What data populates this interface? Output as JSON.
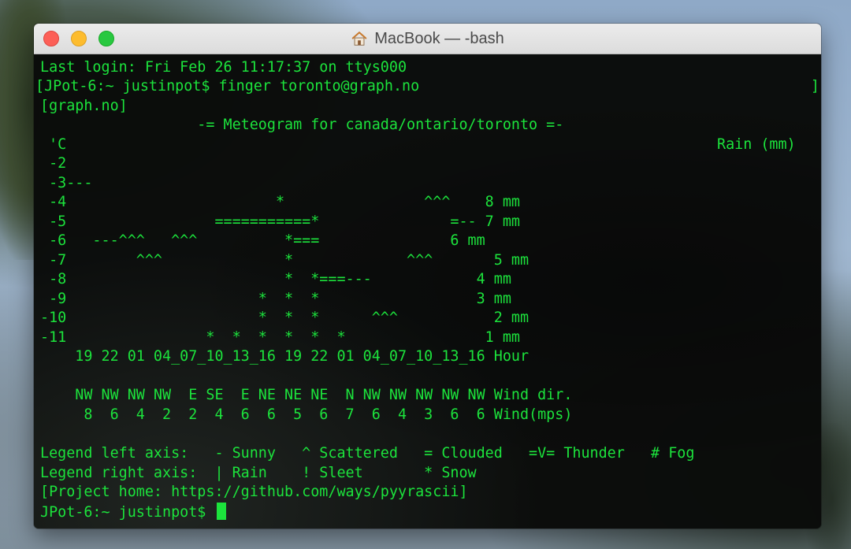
{
  "window": {
    "title": "MacBook — -bash",
    "icons": {
      "title_icon": "home-icon",
      "close": "close-button-icon",
      "minimize": "minimize-button-icon",
      "zoom": "zoom-button-icon"
    },
    "colors": {
      "close": "#fc5f57",
      "minimize": "#fdbc2e",
      "zoom": "#28c840",
      "terminal_text": "#1ce33c"
    }
  },
  "terminal": {
    "login_line": "Last login: Fri Feb 26 11:17:37 on ttys000",
    "command_line": "[JPot-6:~ justinpot$ finger toronto@graph.no",
    "right_bracket": "]",
    "source_line": "[graph.no]",
    "meteogram_title": "                  -= Meteogram for canada/ontario/toronto =-",
    "left_axis_unit": "'C",
    "right_axis_label": "Rain (mm)",
    "chart_rows": [
      " -2",
      " -3---",
      " -4                        *                ^^^    8 mm",
      " -5                 ===========*               =-- 7 mm",
      " -6   ---^^^   ^^^          *===               6 mm",
      " -7        ^^^              *             ^^^       5 mm",
      " -8                         *  *===---            4 mm",
      " -9                      *  *  *                  3 mm",
      "-10                      *  *  *      ^^^           2 mm",
      "-11                *  *  *  *  *  *                1 mm",
      "    19 22 01 04_07_10_13_16 19 22 01 04_07_10_13_16 Hour"
    ],
    "wind_dir_line": "    NW NW NW NW  E SE  E NE NE NE  N NW NW NW NW NW Wind dir.",
    "wind_speed_line": "     8  6  4  2  2  4  6  6  5  6  7  6  4  3  6  6 Wind(mps)",
    "legend_left": "Legend left axis:   - Sunny   ^ Scattered   = Clouded   =V= Thunder   # Fog",
    "legend_right": "Legend right axis:  | Rain    ! Sleet       * Snow",
    "project_home": "[Project home: https://github.com/ways/pyyrascii]",
    "prompt": "JPot-6:~ justinpot$ "
  }
}
